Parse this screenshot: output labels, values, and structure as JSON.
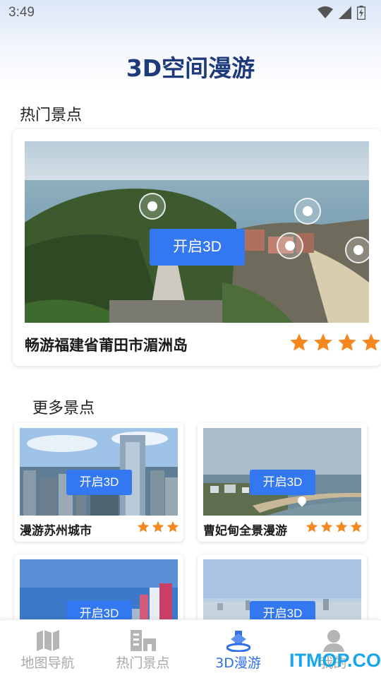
{
  "status_bar": {
    "time": "3:49",
    "icons": [
      "wifi-icon",
      "signal-icon",
      "battery-icon"
    ]
  },
  "page_title": "3D空间漫游",
  "hot_section": {
    "title": "热门景点",
    "featured": {
      "name": "畅游福建省莆田市湄洲岛",
      "button": "开启3D",
      "rating": 4
    }
  },
  "more_section": {
    "title": "更多景点",
    "items": [
      {
        "name": "漫游苏州城市",
        "button": "开启3D",
        "rating": 3
      },
      {
        "name": "曹妃甸全景漫游",
        "button": "开启3D",
        "rating": 4
      },
      {
        "name": "",
        "button": "开启3D",
        "rating": 0
      },
      {
        "name": "",
        "button": "开启3D",
        "rating": 0
      }
    ]
  },
  "bottom_nav": [
    {
      "label": "地图导航",
      "icon": "map-icon",
      "active": false
    },
    {
      "label": "热门景点",
      "icon": "building-icon",
      "active": false
    },
    {
      "label": "3D漫游",
      "icon": "3d-tour-icon",
      "active": true
    },
    {
      "label": "我的",
      "icon": "user-icon",
      "active": false
    }
  ],
  "watermark": "ITMOP.COM",
  "colors": {
    "accent": "#3378f0",
    "star": "#f5871f",
    "title": "#1e3a7a",
    "nav_active": "#2f6fe8"
  }
}
